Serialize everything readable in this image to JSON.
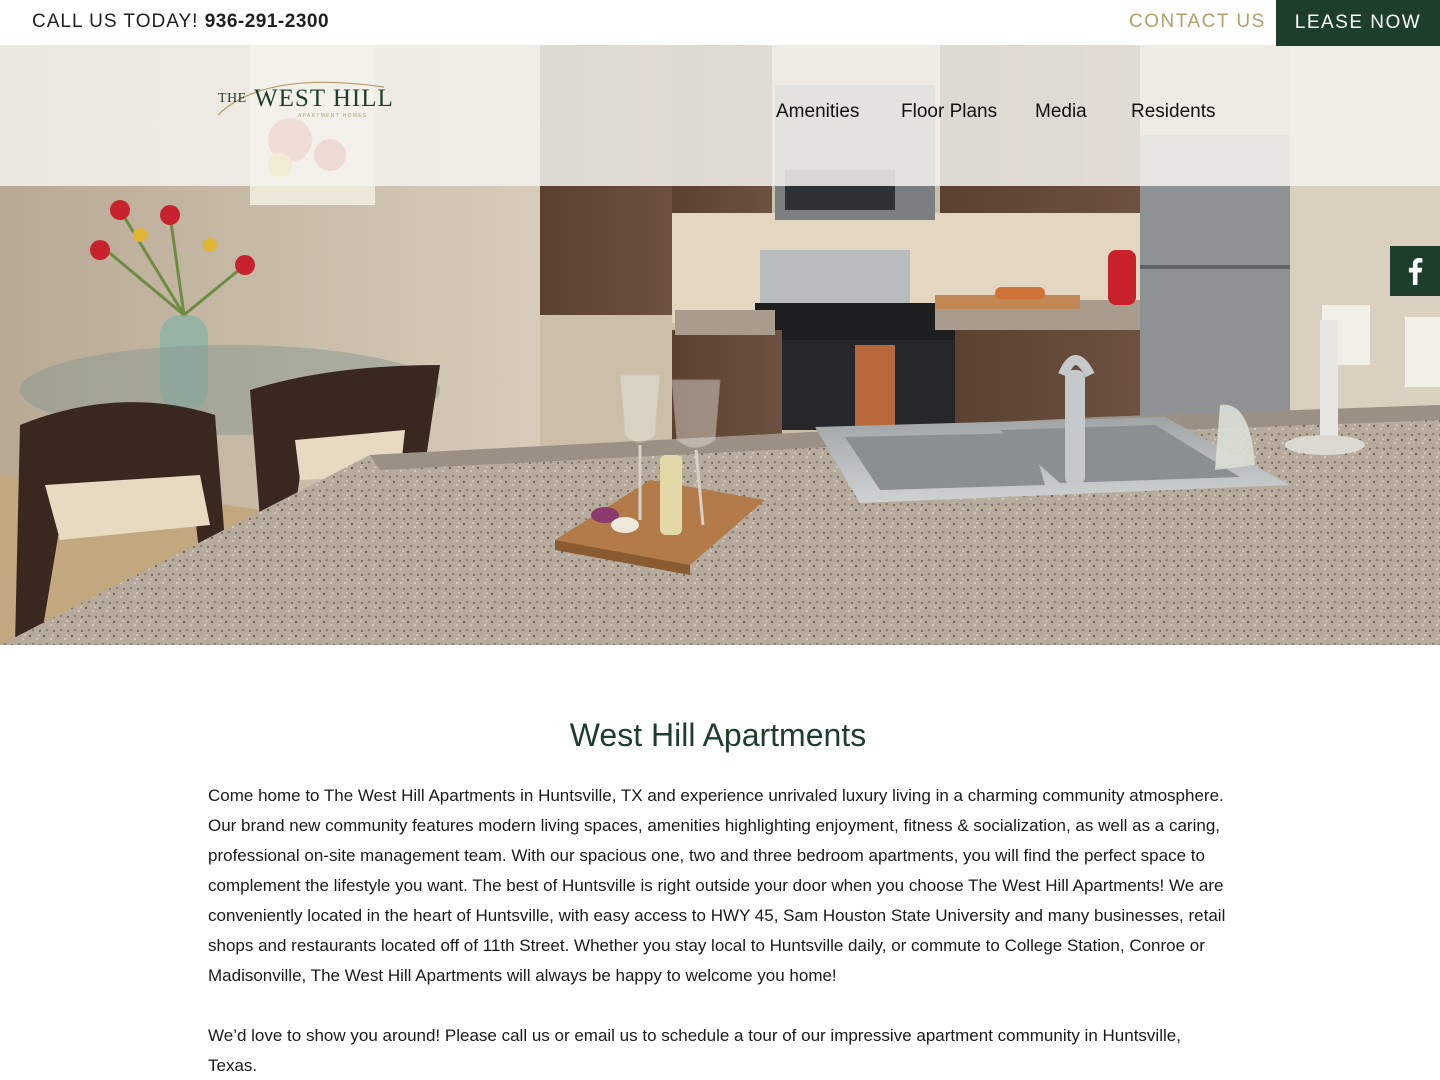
{
  "topbar": {
    "call_label": "CALL US TODAY!",
    "phone": "936-291-2300",
    "contact_label": "CONTACT US",
    "lease_label": "LEASE NOW"
  },
  "logo": {
    "the": "THE",
    "name": "WEST HILL",
    "tagline": "APARTMENT HOMES"
  },
  "nav": {
    "items": [
      {
        "label": "Amenities"
      },
      {
        "label": "Floor Plans"
      },
      {
        "label": "Media"
      },
      {
        "label": "Residents"
      }
    ]
  },
  "social": {
    "facebook_glyph": "f"
  },
  "main": {
    "title": "West Hill Apartments",
    "paragraphs": [
      "Come home to The West Hill Apartments in Huntsville, TX and experience unrivaled luxury living in a charming community atmosphere. Our brand new community features modern living spaces, amenities highlighting enjoyment, fitness & socialization, as well as a caring, professional on-site management team. With our spacious one, two and three bedroom apartments, you will find the perfect space to complement the lifestyle you want. The best of Huntsville is right outside your door when you choose The West Hill Apartments! We are conveniently located in the heart of Huntsville, with easy access to HWY 45, Sam Houston State University and many businesses, retail shops and restaurants located off of 11th Street. Whether you stay local to Huntsville daily, or commute to College Station, Conroe or Madisonville, The West Hill Apartments will always be happy to welcome you home!",
      "We’d love to show you around! Please call us or email us to schedule a tour of our impressive apartment community in Huntsville, Texas."
    ]
  },
  "colors": {
    "brand_green": "#1d3e2a",
    "accent_gold": "#b39f69",
    "text": "#1a1a1a"
  },
  "icons": [
    "facebook-icon"
  ]
}
